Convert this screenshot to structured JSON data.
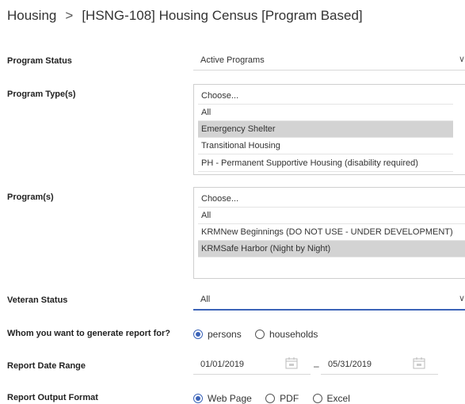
{
  "breadcrumb": {
    "parent": "Housing",
    "separator": ">",
    "current": "[HSNG-108] Housing Census [Program Based]"
  },
  "program_status": {
    "label": "Program Status",
    "value": "Active Programs"
  },
  "program_types": {
    "label": "Program Type(s)",
    "options": [
      {
        "text": "Choose...",
        "selected": false
      },
      {
        "text": "All",
        "selected": false
      },
      {
        "text": "Emergency Shelter",
        "selected": true
      },
      {
        "text": "Transitional Housing",
        "selected": false
      },
      {
        "text": "PH - Permanent Supportive Housing (disability required)",
        "selected": false
      }
    ]
  },
  "programs": {
    "label": "Program(s)",
    "options": [
      {
        "text": "Choose...",
        "selected": false
      },
      {
        "text": "All",
        "selected": false
      },
      {
        "text": "KRMNew Beginnings (DO NOT USE - UNDER DEVELOPMENT)",
        "selected": false
      },
      {
        "text": "KRMSafe Harbor (Night by Night)",
        "selected": true
      }
    ]
  },
  "veteran_status": {
    "label": "Veteran Status",
    "value": "All"
  },
  "report_for": {
    "label": "Whom you want to generate report for?",
    "options": [
      "persons",
      "households"
    ],
    "selected": "persons"
  },
  "date_range": {
    "label": "Report Date Range",
    "start": "01/01/2019",
    "separator": "–",
    "end": "05/31/2019"
  },
  "output_format": {
    "label": "Report Output Format",
    "options": [
      "Web Page",
      "PDF",
      "Excel"
    ],
    "selected": "Web Page"
  },
  "colors": {
    "accent": "#3b63b8",
    "selected_row": "#d3d3d3"
  }
}
